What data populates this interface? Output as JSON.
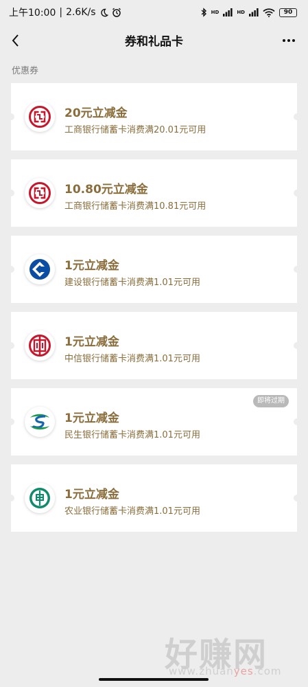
{
  "status_bar": {
    "time": "上午10:00",
    "separator": "|",
    "speed": "2.6K/s",
    "moon_icon": "moon-icon",
    "alarm_icon": "alarm-icon",
    "bluetooth_icon": "bluetooth-icon",
    "signal_label_1": "HD",
    "signal_label_2": "HD",
    "wifi_icon": "wifi-icon",
    "battery": "90"
  },
  "nav": {
    "title": "券和礼品卡",
    "back_icon": "back-arrow-icon",
    "more_icon": "more-dots-icon"
  },
  "section_label": "优惠券",
  "coupons": [
    {
      "title": "20元立减金",
      "desc": "工商银行储蓄卡消费满20.01元可用",
      "bank_icon": "icbc-logo-icon",
      "color": "#c7162b"
    },
    {
      "title": "10.80元立减金",
      "desc": "工商银行储蓄卡消费满10.81元可用",
      "bank_icon": "icbc-logo-icon",
      "color": "#c7162b"
    },
    {
      "title": "1元立减金",
      "desc": "建设银行储蓄卡消费满1.01元可用",
      "bank_icon": "ccb-logo-icon",
      "color": "#0a4da2"
    },
    {
      "title": "1元立减金",
      "desc": "中信银行储蓄卡消费满1.01元可用",
      "bank_icon": "citic-logo-icon",
      "color": "#c7162b"
    },
    {
      "title": "1元立减金",
      "desc": "民生银行储蓄卡消费满1.01元可用",
      "bank_icon": "cmbc-logo-icon",
      "color": "#1a9a4a",
      "badge": "即将过期"
    },
    {
      "title": "1元立减金",
      "desc": "农业银行储蓄卡消费满1.01元可用",
      "bank_icon": "abc-logo-icon",
      "color": "#0f8a6d"
    }
  ],
  "watermark": {
    "main": "好赚网",
    "url_prefix": "www.zhuan",
    "url_accent": "yes",
    "url_suffix": ".com"
  },
  "colors": {
    "background": "#ededed",
    "coupon_text": "#8a6d3b"
  }
}
